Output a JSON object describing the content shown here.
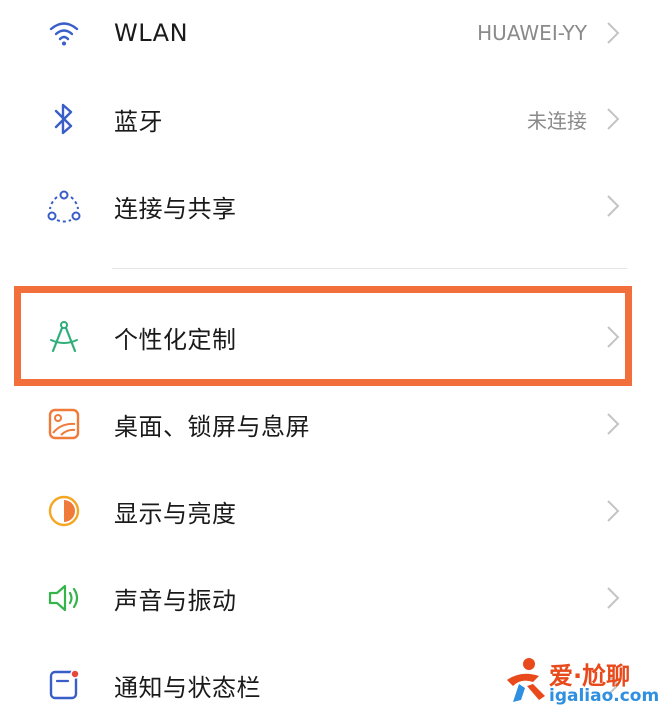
{
  "settings": {
    "items": [
      {
        "label": "WLAN",
        "value": "HUAWEI-YY"
      },
      {
        "label": "蓝牙",
        "value": "未连接"
      },
      {
        "label": "连接与共享",
        "value": ""
      },
      {
        "label": "个性化定制",
        "value": ""
      },
      {
        "label": "桌面、锁屏与息屏",
        "value": ""
      },
      {
        "label": "显示与亮度",
        "value": ""
      },
      {
        "label": "声音与振动",
        "value": ""
      },
      {
        "label": "通知与状态栏",
        "value": ""
      }
    ]
  },
  "icons": {
    "wlan": "wifi-icon",
    "bluetooth": "bluetooth-icon",
    "sharing": "connection-share-icon",
    "personalize": "compass-icon",
    "desktop": "wallpaper-icon",
    "display": "brightness-icon",
    "sound": "speaker-icon",
    "notification": "notification-icon",
    "chevron": "chevron-right-icon"
  },
  "colors": {
    "highlight": "#f26f3c",
    "wifi": "#3a5ec7",
    "bluetooth": "#3a5ec7",
    "personalize": "#2fae7a",
    "desktop": "#f07a3a",
    "display": "#f5a623",
    "sound": "#35b44a",
    "notification": "#3a5ec7"
  },
  "watermark": {
    "title": "爱·尬聊",
    "url": "igaliao.com"
  }
}
